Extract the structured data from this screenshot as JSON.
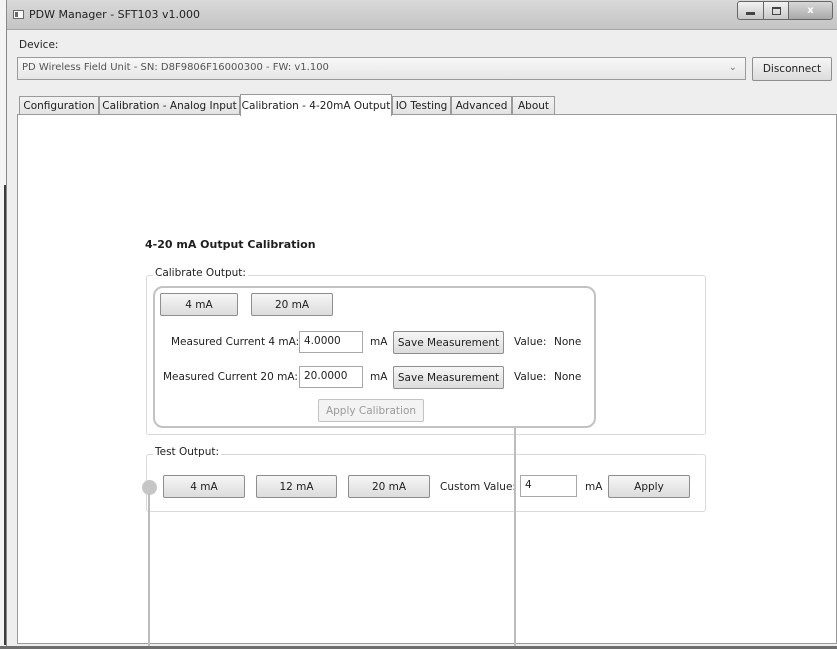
{
  "window": {
    "title": "PDW Manager - SFT103 v1.000",
    "controls": {
      "minimize": "minimize",
      "maximize": "maximize",
      "close": "x"
    }
  },
  "device": {
    "label": "Device:",
    "selected": "PD Wireless Field Unit - SN: D8F9806F16000300 - FW: v1.100",
    "disconnect_label": "Disconnect"
  },
  "tabs": [
    {
      "label": "Configuration",
      "active": false
    },
    {
      "label": "Calibration - Analog Input",
      "active": false
    },
    {
      "label": "Calibration - 4-20mA Output",
      "active": true
    },
    {
      "label": "IO Testing",
      "active": false
    },
    {
      "label": "Advanced",
      "active": false
    },
    {
      "label": "About",
      "active": false
    }
  ],
  "calibration": {
    "title": "4-20 mA Output Calibration",
    "calibrate_group_label": "Calibrate Output:",
    "btn_4ma": "4 mA",
    "btn_20ma": "20 mA",
    "row1": {
      "label": "Measured Current 4 mA:",
      "value": "4.0000",
      "unit": "mA",
      "save_label": "Save Measurement",
      "value_label": "Value:",
      "value_text": "None"
    },
    "row2": {
      "label": "Measured Current 20 mA:",
      "value": "20.0000",
      "unit": "mA",
      "save_label": "Save Measurement",
      "value_label": "Value:",
      "value_text": "None"
    },
    "apply_label": "Apply Calibration"
  },
  "test_output": {
    "group_label": "Test Output:",
    "btn_4ma": "4 mA",
    "btn_12ma": "12 mA",
    "btn_20ma": "20 mA",
    "custom_label": "Custom Value:",
    "custom_value": "4",
    "unit": "mA",
    "apply_label": "Apply"
  }
}
